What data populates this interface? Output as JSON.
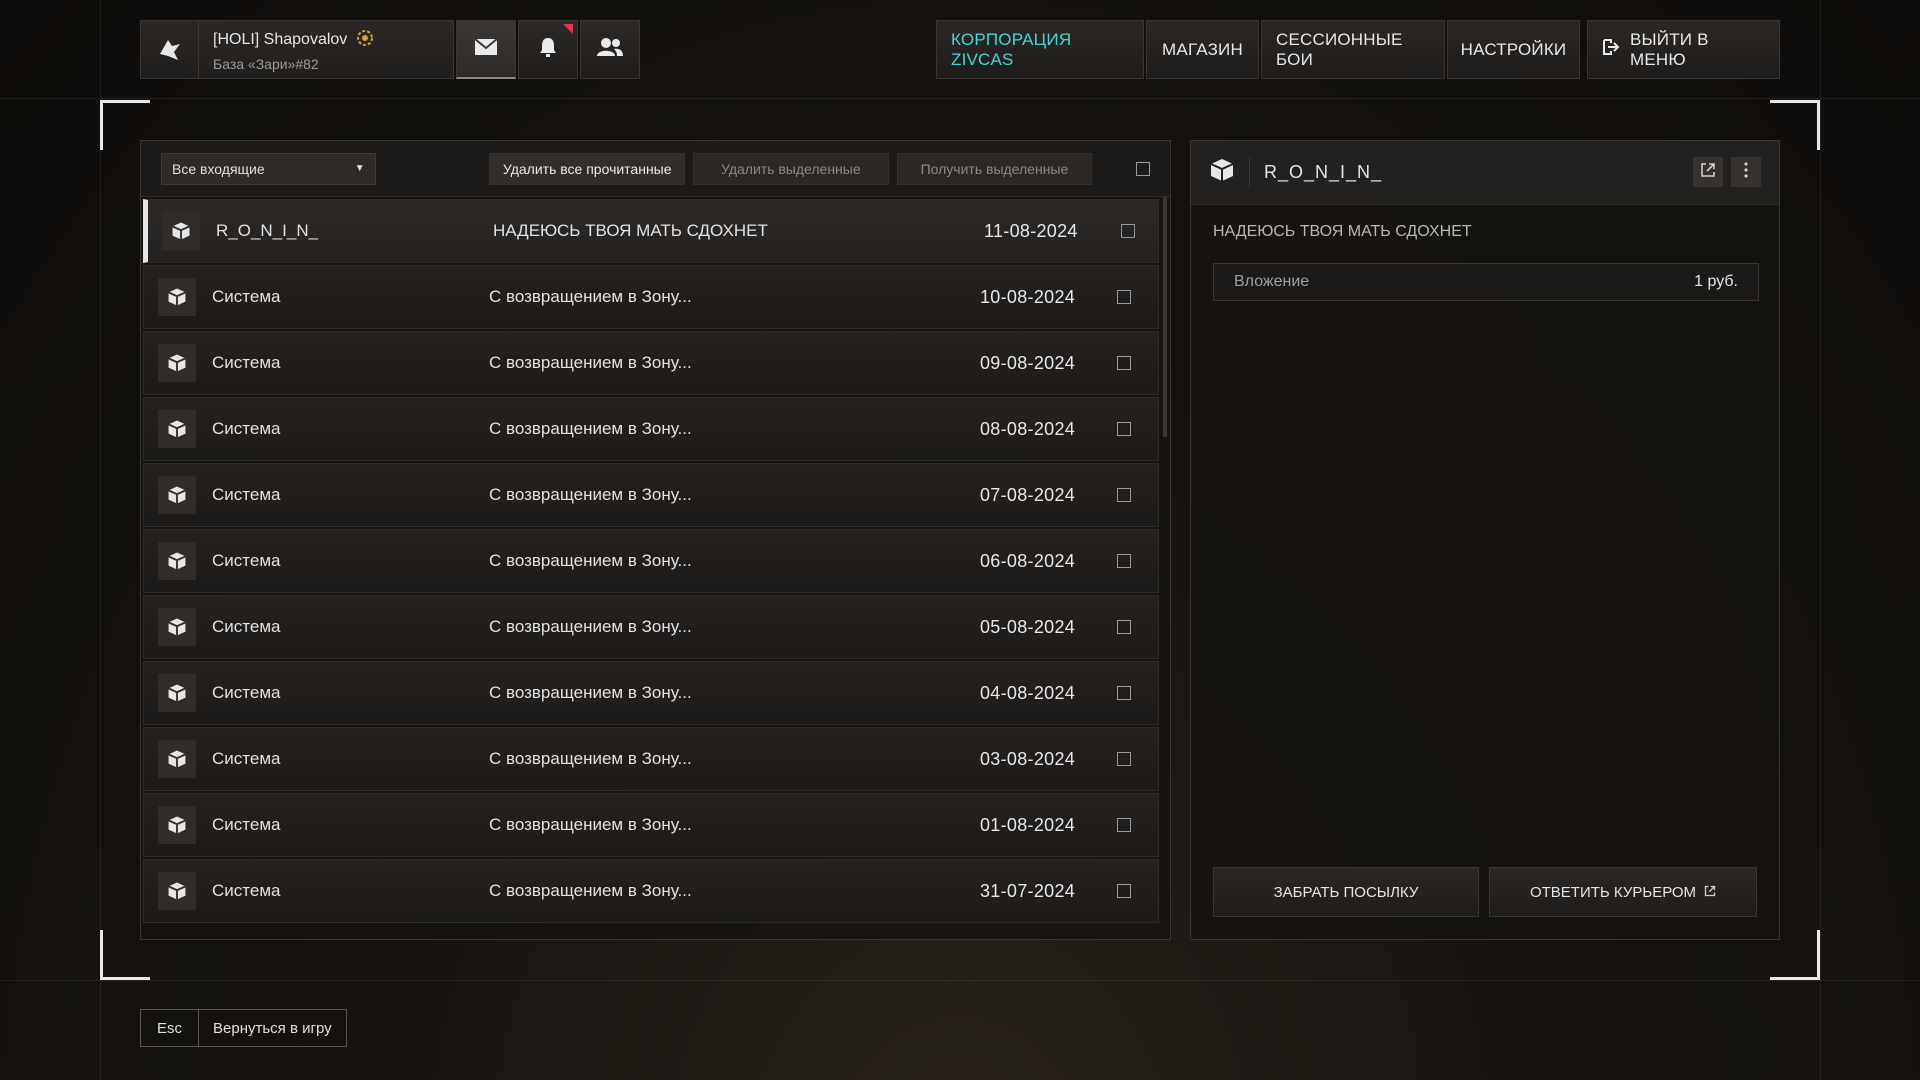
{
  "profile": {
    "name": "[HOLI] Shapovalov",
    "base": "База «Зари»#82"
  },
  "nav": {
    "corporation": "КОРПОРАЦИЯ ZIVCAS",
    "shop": "МАГАЗИН",
    "sessions": "СЕССИОННЫЕ БОИ",
    "settings": "НАСТРОЙКИ",
    "exit": "ВЫЙТИ В МЕНЮ"
  },
  "colors": {
    "accent": "#46d6d6",
    "notif": "#e0384b"
  },
  "toolbar": {
    "filter_value": "Все входящие",
    "delete_read": "Удалить все прочитанные",
    "delete_selected": "Удалить выделенные",
    "receive_selected": "Получить выделенные"
  },
  "messages": [
    {
      "sender": "R_O_N_I_N_",
      "subject": "НАДЕЮСЬ ТВОЯ МАТЬ СДОХНЕТ",
      "date": "11-08-2024"
    },
    {
      "sender": "Система",
      "subject": "С возвращением в Зону...",
      "date": "10-08-2024"
    },
    {
      "sender": "Система",
      "subject": "С возвращением в Зону...",
      "date": "09-08-2024"
    },
    {
      "sender": "Система",
      "subject": "С возвращением в Зону...",
      "date": "08-08-2024"
    },
    {
      "sender": "Система",
      "subject": "С возвращением в Зону...",
      "date": "07-08-2024"
    },
    {
      "sender": "Система",
      "subject": "С возвращением в Зону...",
      "date": "06-08-2024"
    },
    {
      "sender": "Система",
      "subject": "С возвращением в Зону...",
      "date": "05-08-2024"
    },
    {
      "sender": "Система",
      "subject": "С возвращением в Зону...",
      "date": "04-08-2024"
    },
    {
      "sender": "Система",
      "subject": "С возвращением в Зону...",
      "date": "03-08-2024"
    },
    {
      "sender": "Система",
      "subject": "С возвращением в Зону...",
      "date": "01-08-2024"
    },
    {
      "sender": "Система",
      "subject": "С возвращением в Зону...",
      "date": "31-07-2024"
    }
  ],
  "detail": {
    "sender": "R_O_N_I_N_",
    "subject": "НАДЕЮСЬ ТВОЯ МАТЬ СДОХНЕТ",
    "attachment_label": "Вложение",
    "attachment_value": "1 руб.",
    "take_parcel": "ЗАБРАТЬ ПОСЫЛКУ",
    "reply_courier": "ОТВЕТИТЬ КУРЬЕРОМ"
  },
  "footer": {
    "key": "Esc",
    "label": "Вернуться в игру"
  }
}
